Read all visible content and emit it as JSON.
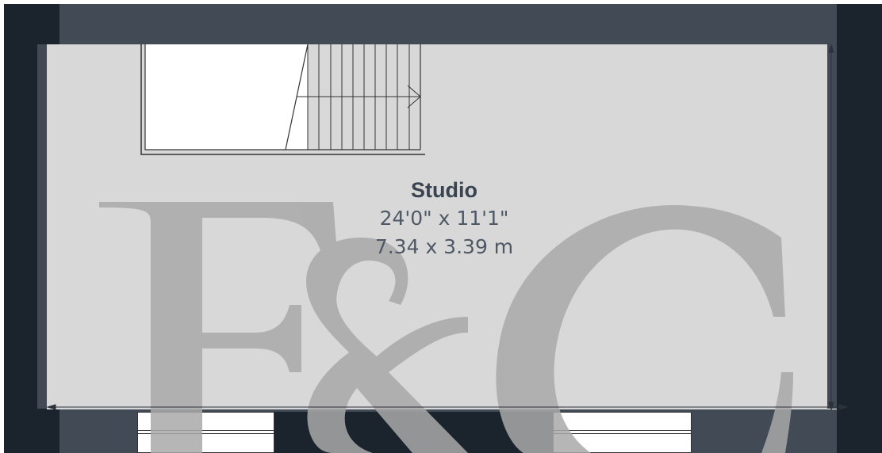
{
  "plan": {
    "room": {
      "name": "Studio",
      "dimensions_imperial": "24'0\" x 11'1\"",
      "dimensions_metric": "7.34 x 3.39 m"
    },
    "watermark_text": "F&C",
    "colors": {
      "wall_dark": "#1b232c",
      "wall_mid": "#414a55",
      "floor": "#d8d8d8",
      "watermark": "#a9a9a9",
      "label": "#3a4450"
    }
  }
}
